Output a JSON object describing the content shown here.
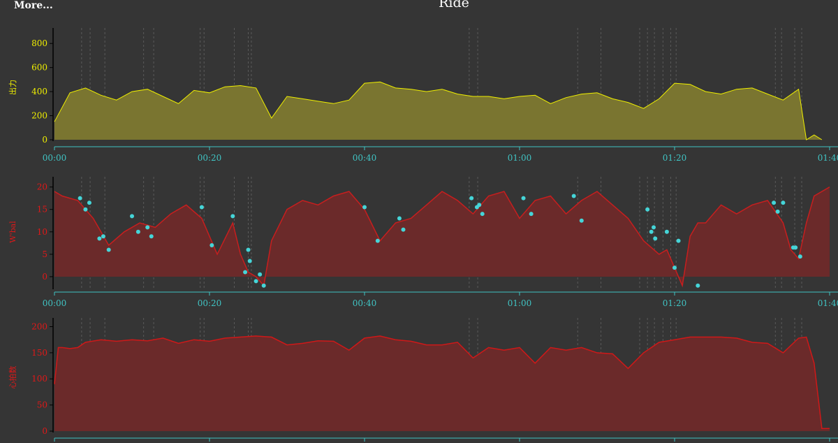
{
  "header": {
    "more_label": "More...",
    "title": "Ride"
  },
  "colors": {
    "background": "#353535",
    "axis": "#40c4c4",
    "power": "#f0f000",
    "power_fill": "#7a7530",
    "wbal": "#c81e1e",
    "wbal_fill": "#6b2a2a",
    "hr": "#d01818",
    "hr_fill": "#6b2a2a",
    "marker": "#45d5d8",
    "tick_label_power": "#f0f000",
    "tick_label_red": "#e01818",
    "grid": "#5a5a5a"
  },
  "chart_data": [
    {
      "type": "area",
      "name": "power",
      "ylabel": "出力",
      "yticks": [
        0,
        200,
        400,
        600,
        800
      ],
      "ylim": [
        0,
        900
      ],
      "xlim": [
        0,
        100
      ],
      "xticks": [
        "00:00",
        "00:20",
        "00:40",
        "01:00",
        "01:20",
        "01:40"
      ],
      "x_units": "minutes",
      "x": [
        0,
        2,
        4,
        6,
        8,
        10,
        12,
        14,
        16,
        18,
        20,
        22,
        24,
        26,
        28,
        30,
        32,
        34,
        36,
        38,
        40,
        42,
        44,
        46,
        48,
        50,
        52,
        54,
        56,
        58,
        60,
        62,
        64,
        66,
        68,
        70,
        72,
        74,
        76,
        78,
        80,
        82,
        84,
        86,
        88,
        90,
        92,
        94,
        96,
        97,
        98,
        99
      ],
      "values": [
        150,
        390,
        430,
        370,
        330,
        400,
        420,
        360,
        300,
        410,
        390,
        440,
        450,
        430,
        180,
        360,
        340,
        320,
        300,
        330,
        470,
        480,
        430,
        420,
        400,
        420,
        380,
        360,
        360,
        340,
        360,
        370,
        300,
        350,
        380,
        390,
        340,
        310,
        260,
        340,
        470,
        460,
        400,
        380,
        420,
        430,
        380,
        330,
        420,
        0,
        40,
        0
      ]
    },
    {
      "type": "area",
      "name": "wbal",
      "ylabel": "W'bal",
      "yticks": [
        0,
        5,
        10,
        15,
        20
      ],
      "ylim": [
        -2.5,
        21.5
      ],
      "xlim": [
        0,
        100
      ],
      "xticks": [
        "00:00",
        "00:20",
        "00:40",
        "01:00",
        "01:20",
        "01:40"
      ],
      "x_units": "minutes",
      "x": [
        0,
        1,
        3,
        5,
        7,
        9,
        11,
        13,
        15,
        17,
        19,
        21,
        23,
        24,
        25,
        26,
        27,
        28,
        30,
        32,
        34,
        36,
        38,
        40,
        42,
        44,
        46,
        48,
        50,
        52,
        54,
        56,
        58,
        60,
        62,
        64,
        66,
        68,
        70,
        72,
        74,
        76,
        78,
        79,
        80,
        81,
        82,
        83,
        84,
        86,
        88,
        90,
        92,
        94,
        95,
        96,
        97,
        98,
        100
      ],
      "values": [
        19,
        18,
        17,
        13,
        7,
        10,
        12,
        11,
        14,
        16,
        13,
        5,
        12,
        5,
        1,
        0,
        -2,
        8,
        15,
        17,
        16,
        18,
        19,
        15,
        8,
        12,
        13,
        16,
        19,
        17,
        14,
        18,
        19,
        13,
        17,
        18,
        14,
        17,
        19,
        16,
        13,
        8,
        5,
        6,
        2,
        -2,
        9,
        12,
        12,
        16,
        14,
        16,
        17,
        12,
        6,
        4,
        12,
        18,
        20
      ],
      "markers": [
        {
          "x": 3.3,
          "y": 17.5
        },
        {
          "x": 4.0,
          "y": 15.0
        },
        {
          "x": 4.5,
          "y": 16.5
        },
        {
          "x": 5.8,
          "y": 8.5
        },
        {
          "x": 6.3,
          "y": 9.0
        },
        {
          "x": 7.0,
          "y": 6.0
        },
        {
          "x": 10.0,
          "y": 13.5
        },
        {
          "x": 10.8,
          "y": 10.0
        },
        {
          "x": 12.0,
          "y": 11.0
        },
        {
          "x": 12.5,
          "y": 9.0
        },
        {
          "x": 19.0,
          "y": 15.5
        },
        {
          "x": 20.3,
          "y": 7.0
        },
        {
          "x": 23.0,
          "y": 13.5
        },
        {
          "x": 24.6,
          "y": 1.0
        },
        {
          "x": 25.0,
          "y": 6.0
        },
        {
          "x": 25.2,
          "y": 3.5
        },
        {
          "x": 26.0,
          "y": -1.0
        },
        {
          "x": 26.5,
          "y": 0.5
        },
        {
          "x": 27.0,
          "y": -2.0
        },
        {
          "x": 40.0,
          "y": 15.5
        },
        {
          "x": 41.7,
          "y": 8.0
        },
        {
          "x": 44.5,
          "y": 13.0
        },
        {
          "x": 45.0,
          "y": 10.5
        },
        {
          "x": 53.8,
          "y": 17.5
        },
        {
          "x": 54.5,
          "y": 15.5
        },
        {
          "x": 54.8,
          "y": 16.0
        },
        {
          "x": 55.2,
          "y": 14.0
        },
        {
          "x": 60.5,
          "y": 17.5
        },
        {
          "x": 61.5,
          "y": 14.0
        },
        {
          "x": 67.0,
          "y": 18.0
        },
        {
          "x": 68.0,
          "y": 12.5
        },
        {
          "x": 76.5,
          "y": 15.0
        },
        {
          "x": 77.0,
          "y": 10.0
        },
        {
          "x": 77.3,
          "y": 11.0
        },
        {
          "x": 77.5,
          "y": 8.5
        },
        {
          "x": 79.0,
          "y": 10.0
        },
        {
          "x": 80.0,
          "y": 2.0
        },
        {
          "x": 80.5,
          "y": 8.0
        },
        {
          "x": 83.0,
          "y": -2.0
        },
        {
          "x": 92.8,
          "y": 16.5
        },
        {
          "x": 93.3,
          "y": 14.5
        },
        {
          "x": 94.0,
          "y": 16.5
        },
        {
          "x": 95.3,
          "y": 6.5
        },
        {
          "x": 95.6,
          "y": 6.5
        },
        {
          "x": 96.2,
          "y": 4.5
        }
      ]
    },
    {
      "type": "area",
      "name": "heart_rate",
      "ylabel": "心拍数",
      "yticks": [
        0,
        50,
        100,
        150,
        200
      ],
      "ylim": [
        0,
        210
      ],
      "xlim": [
        0,
        100
      ],
      "x_units": "minutes",
      "x": [
        0,
        0.5,
        1,
        2,
        3,
        4,
        6,
        8,
        10,
        12,
        14,
        16,
        18,
        20,
        22,
        24,
        26,
        28,
        30,
        32,
        34,
        36,
        38,
        40,
        42,
        44,
        46,
        48,
        50,
        52,
        54,
        56,
        58,
        60,
        62,
        64,
        66,
        68,
        70,
        72,
        74,
        76,
        78,
        80,
        82,
        84,
        86,
        88,
        90,
        92,
        94,
        96,
        97,
        98,
        99,
        100
      ],
      "values": [
        90,
        160,
        160,
        158,
        160,
        170,
        175,
        172,
        175,
        173,
        178,
        168,
        175,
        172,
        178,
        180,
        182,
        180,
        165,
        168,
        173,
        172,
        155,
        178,
        182,
        175,
        172,
        165,
        165,
        170,
        140,
        160,
        155,
        160,
        130,
        160,
        155,
        160,
        150,
        148,
        120,
        150,
        170,
        175,
        180,
        180,
        180,
        178,
        170,
        168,
        150,
        178,
        180,
        130,
        5,
        5
      ]
    }
  ]
}
